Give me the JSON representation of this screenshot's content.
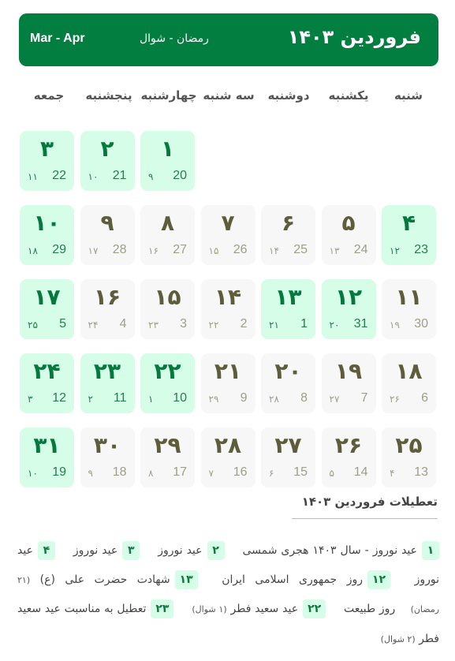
{
  "header": {
    "title": "فروردین ۱۴۰۳",
    "hijri_months": "رمضان - شوال",
    "gregorian_months": "Mar - Apr",
    "background_color": "#017e40"
  },
  "weekdays": [
    "شنبه",
    "یکشنبه",
    "دوشنبه",
    "سه شنبه",
    "چهارشنبه",
    "پنجشنبه",
    "جمعه"
  ],
  "calendar": {
    "leading_empty_cells": 4,
    "holiday_color": "#d5fde7",
    "days": [
      {
        "day": "۱",
        "gregorian": "20",
        "hijri": "۹",
        "holiday": true
      },
      {
        "day": "۲",
        "gregorian": "21",
        "hijri": "۱۰",
        "holiday": true
      },
      {
        "day": "۳",
        "gregorian": "22",
        "hijri": "۱۱",
        "holiday": true
      },
      {
        "day": "۴",
        "gregorian": "23",
        "hijri": "۱۲",
        "holiday": true
      },
      {
        "day": "۵",
        "gregorian": "24",
        "hijri": "۱۳",
        "holiday": false
      },
      {
        "day": "۶",
        "gregorian": "25",
        "hijri": "۱۴",
        "holiday": false
      },
      {
        "day": "۷",
        "gregorian": "26",
        "hijri": "۱۵",
        "holiday": false
      },
      {
        "day": "۸",
        "gregorian": "27",
        "hijri": "۱۶",
        "holiday": false
      },
      {
        "day": "۹",
        "gregorian": "28",
        "hijri": "۱۷",
        "holiday": false
      },
      {
        "day": "۱۰",
        "gregorian": "29",
        "hijri": "۱۸",
        "holiday": true
      },
      {
        "day": "۱۱",
        "gregorian": "30",
        "hijri": "۱۹",
        "holiday": false
      },
      {
        "day": "۱۲",
        "gregorian": "31",
        "hijri": "۲۰",
        "holiday": true
      },
      {
        "day": "۱۳",
        "gregorian": "1",
        "hijri": "۲۱",
        "holiday": true
      },
      {
        "day": "۱۴",
        "gregorian": "2",
        "hijri": "۲۲",
        "holiday": false
      },
      {
        "day": "۱۵",
        "gregorian": "3",
        "hijri": "۲۳",
        "holiday": false
      },
      {
        "day": "۱۶",
        "gregorian": "4",
        "hijri": "۲۴",
        "holiday": false
      },
      {
        "day": "۱۷",
        "gregorian": "5",
        "hijri": "۲۵",
        "holiday": true
      },
      {
        "day": "۱۸",
        "gregorian": "6",
        "hijri": "۲۶",
        "holiday": false
      },
      {
        "day": "۱۹",
        "gregorian": "7",
        "hijri": "۲۷",
        "holiday": false
      },
      {
        "day": "۲۰",
        "gregorian": "8",
        "hijri": "۲۸",
        "holiday": false
      },
      {
        "day": "۲۱",
        "gregorian": "9",
        "hijri": "۲۹",
        "holiday": false
      },
      {
        "day": "۲۲",
        "gregorian": "10",
        "hijri": "۱",
        "holiday": true
      },
      {
        "day": "۲۳",
        "gregorian": "11",
        "hijri": "۲",
        "holiday": true
      },
      {
        "day": "۲۴",
        "gregorian": "12",
        "hijri": "۳",
        "holiday": true
      },
      {
        "day": "۲۵",
        "gregorian": "13",
        "hijri": "۴",
        "holiday": false
      },
      {
        "day": "۲۶",
        "gregorian": "14",
        "hijri": "۵",
        "holiday": false
      },
      {
        "day": "۲۷",
        "gregorian": "15",
        "hijri": "۶",
        "holiday": false
      },
      {
        "day": "۲۸",
        "gregorian": "16",
        "hijri": "۷",
        "holiday": false
      },
      {
        "day": "۲۹",
        "gregorian": "17",
        "hijri": "۸",
        "holiday": false
      },
      {
        "day": "۳۰",
        "gregorian": "18",
        "hijri": "۹",
        "holiday": false
      },
      {
        "day": "۳۱",
        "gregorian": "19",
        "hijri": "۱۰",
        "holiday": true
      }
    ]
  },
  "holidays_section": {
    "title": "تعطیلات فروردین ۱۴۰۳",
    "items": [
      {
        "day": "۱",
        "text": "عید نوروز - سال ۱۴۰۳ هجری شمسی",
        "note": ""
      },
      {
        "day": "۲",
        "text": "عید نوروز",
        "note": ""
      },
      {
        "day": "۳",
        "text": "عید نوروز",
        "note": ""
      },
      {
        "day": "۴",
        "text": "عید نوروز",
        "note": ""
      },
      {
        "day": "۱۲",
        "text": "روز جمهوری اسلامی ایران",
        "note": ""
      },
      {
        "day": "۱۳",
        "text": "شهادت حضرت علی (ع)",
        "note": "(۲۱ رمضان)",
        "extra": "روز طبیعت"
      },
      {
        "day": "۲۲",
        "text": "عید سعید فطر",
        "note": "(۱ شوال)"
      },
      {
        "day": "۲۳",
        "text": "تعطیل به مناسبت عید سعید فطر",
        "note": "(۲ شوال)"
      }
    ]
  }
}
